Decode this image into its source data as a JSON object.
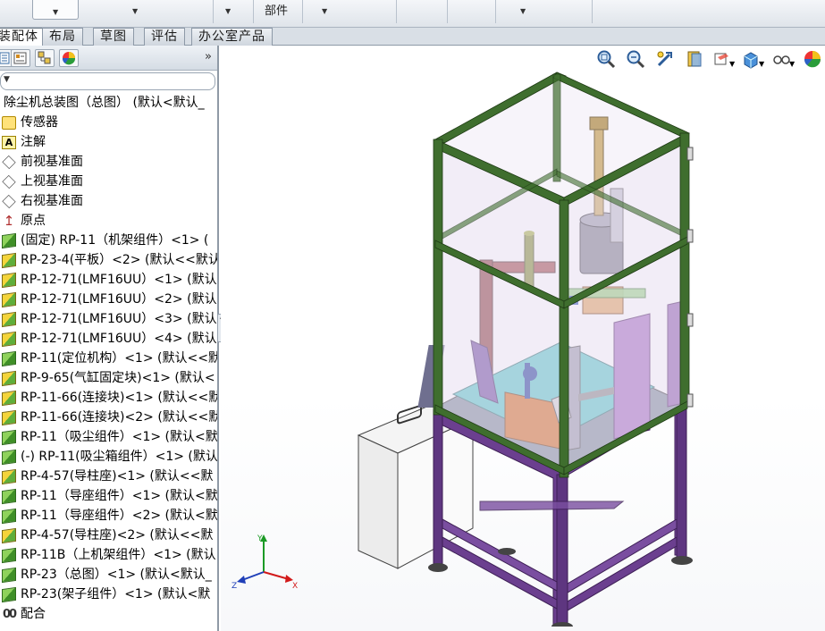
{
  "ribbon": {
    "cropped_label": "部件"
  },
  "command_tabs": [
    {
      "label": "装配体",
      "active": true
    },
    {
      "label": "布局",
      "active": false
    },
    {
      "label": "草图",
      "active": false
    },
    {
      "label": "评估",
      "active": false
    },
    {
      "label": "办公室产品",
      "active": false
    }
  ],
  "feature_manager": {
    "expand_glyph": "»",
    "filter_arrow": "▼",
    "root": "除尘机总装图（总图） (默认<默认_",
    "items": [
      {
        "label": "传感器",
        "icon": "sensor-icon"
      },
      {
        "label": "注解",
        "icon": "annotation-icon"
      },
      {
        "label": "前视基准面",
        "icon": "plane-icon"
      },
      {
        "label": "上视基准面",
        "icon": "plane-icon"
      },
      {
        "label": "右视基准面",
        "icon": "plane-icon"
      },
      {
        "label": "原点",
        "icon": "origin-icon"
      },
      {
        "label": "(固定) RP-11（机架组件）<1> (",
        "icon": "subassembly-icon"
      },
      {
        "label": "RP-23-4(平板）<2> (默认<<默认",
        "icon": "part-icon"
      },
      {
        "label": "RP-12-71(LMF16UU）<1> (默认",
        "icon": "part-icon"
      },
      {
        "label": "RP-12-71(LMF16UU）<2> (默认",
        "icon": "part-icon"
      },
      {
        "label": "RP-12-71(LMF16UU）<3> (默认",
        "icon": "part-icon"
      },
      {
        "label": "RP-12-71(LMF16UU）<4> (默认",
        "icon": "part-icon"
      },
      {
        "label": "RP-11(定位机构）<1> (默认<<默",
        "icon": "subassembly-icon"
      },
      {
        "label": "RP-9-65(气缸固定块)<1> (默认<",
        "icon": "part-icon"
      },
      {
        "label": "RP-11-66(连接块)<1> (默认<<默",
        "icon": "part-icon"
      },
      {
        "label": "RP-11-66(连接块)<2> (默认<<默",
        "icon": "part-icon"
      },
      {
        "label": "RP-11（吸尘组件）<1> (默认<默",
        "icon": "subassembly-icon"
      },
      {
        "label": "(-) RP-11(吸尘箱组件）<1> (默认",
        "icon": "subassembly-icon"
      },
      {
        "label": "RP-4-57(导柱座)<1> (默认<<默",
        "icon": "part-icon"
      },
      {
        "label": "RP-11（导座组件）<1> (默认<默",
        "icon": "subassembly-icon"
      },
      {
        "label": "RP-11（导座组件）<2> (默认<默",
        "icon": "subassembly-icon"
      },
      {
        "label": "RP-4-57(导柱座)<2> (默认<<默",
        "icon": "part-icon"
      },
      {
        "label": "RP-11B（上机架组件）<1> (默认",
        "icon": "subassembly-icon"
      },
      {
        "label": "RP-23（总图）<1> (默认<默认_",
        "icon": "subassembly-icon"
      },
      {
        "label": "RP-23(架子组件）<1> (默认<默",
        "icon": "subassembly-icon"
      },
      {
        "label": "配合",
        "icon": "mates-icon"
      }
    ]
  },
  "triad": {
    "x": "X",
    "y": "Y",
    "z": "Z"
  },
  "colors": {
    "frame_green": "#3f6e2e",
    "frame_purple": "#6b3f8f",
    "glass": "#e7dff0",
    "plate_cyan": "#57c8c8",
    "accent_orange": "#d46b1d"
  }
}
